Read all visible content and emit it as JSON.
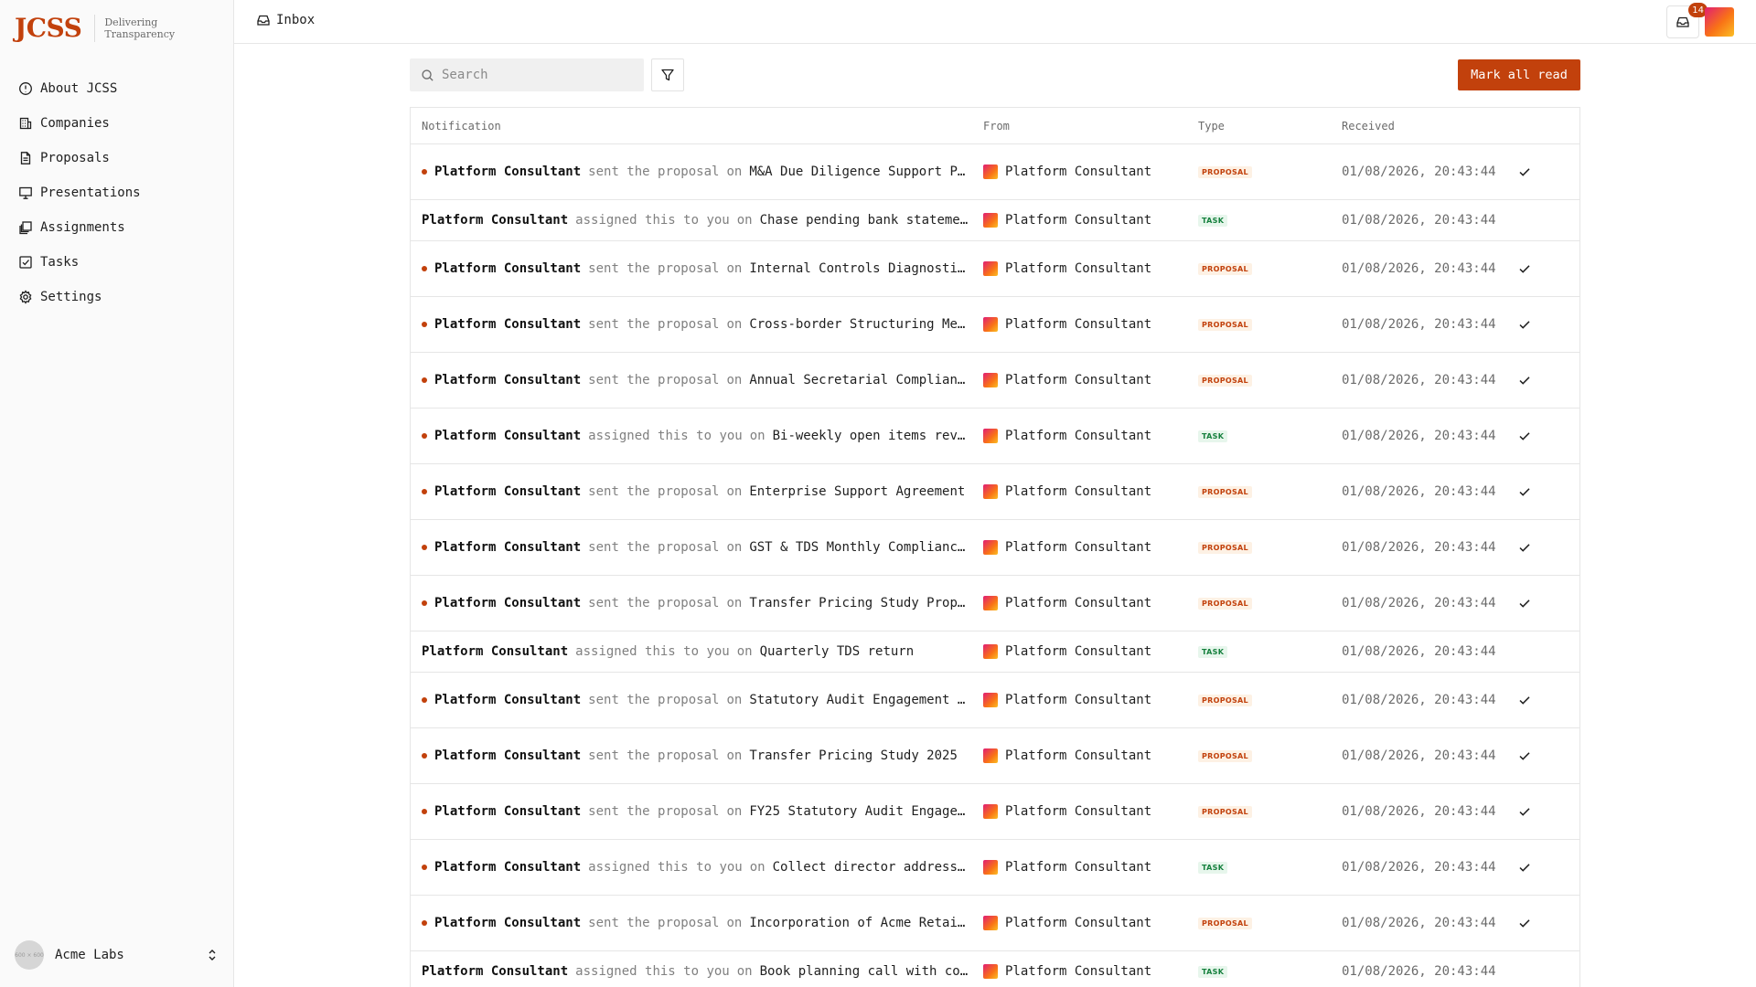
{
  "brand": {
    "logo": "JCSS",
    "tagline": "Delivering Transparency"
  },
  "sidebar": {
    "items": [
      {
        "label": "About JCSS",
        "icon": "info-icon"
      },
      {
        "label": "Companies",
        "icon": "building-icon"
      },
      {
        "label": "Proposals",
        "icon": "document-icon"
      },
      {
        "label": "Presentations",
        "icon": "presentation-icon"
      },
      {
        "label": "Assignments",
        "icon": "stack-icon"
      },
      {
        "label": "Tasks",
        "icon": "checkbox-icon"
      },
      {
        "label": "Settings",
        "icon": "gear-icon"
      }
    ],
    "workspace": {
      "name": "Acme Labs",
      "avatar_text": "600 × 600"
    }
  },
  "header": {
    "breadcrumb": "Inbox",
    "inbox_count": "14"
  },
  "toolbar": {
    "search_placeholder": "Search",
    "mark_all_read": "Mark all read"
  },
  "table": {
    "columns": {
      "notification": "Notification",
      "from": "From",
      "type": "Type",
      "received": "Received"
    },
    "rows": [
      {
        "unread": true,
        "actor": "Platform Consultant",
        "verb": "sent the proposal",
        "prep": "on",
        "subject": "M&A Due Diligence Support P…",
        "from": "Platform Consultant",
        "type": "PROPOSAL",
        "received": "01/08/2026, 20:43:44"
      },
      {
        "unread": false,
        "actor": "Platform Consultant",
        "verb": "assigned this to you",
        "prep": "on",
        "subject": "Chase pending bank stateme…",
        "from": "Platform Consultant",
        "type": "TASK",
        "received": "01/08/2026, 20:43:44"
      },
      {
        "unread": true,
        "actor": "Platform Consultant",
        "verb": "sent the proposal",
        "prep": "on",
        "subject": "Internal Controls Diagnosti…",
        "from": "Platform Consultant",
        "type": "PROPOSAL",
        "received": "01/08/2026, 20:43:44"
      },
      {
        "unread": true,
        "actor": "Platform Consultant",
        "verb": "sent the proposal",
        "prep": "on",
        "subject": "Cross-border Structuring Me…",
        "from": "Platform Consultant",
        "type": "PROPOSAL",
        "received": "01/08/2026, 20:43:44"
      },
      {
        "unread": true,
        "actor": "Platform Consultant",
        "verb": "sent the proposal",
        "prep": "on",
        "subject": "Annual Secretarial Complian…",
        "from": "Platform Consultant",
        "type": "PROPOSAL",
        "received": "01/08/2026, 20:43:44"
      },
      {
        "unread": true,
        "actor": "Platform Consultant",
        "verb": "assigned this to you",
        "prep": "on",
        "subject": "Bi-weekly open items rev…",
        "from": "Platform Consultant",
        "type": "TASK",
        "received": "01/08/2026, 20:43:44"
      },
      {
        "unread": true,
        "actor": "Platform Consultant",
        "verb": "sent the proposal",
        "prep": "on",
        "subject": "Enterprise Support Agreement",
        "from": "Platform Consultant",
        "type": "PROPOSAL",
        "received": "01/08/2026, 20:43:44"
      },
      {
        "unread": true,
        "actor": "Platform Consultant",
        "verb": "sent the proposal",
        "prep": "on",
        "subject": "GST & TDS Monthly Complianc…",
        "from": "Platform Consultant",
        "type": "PROPOSAL",
        "received": "01/08/2026, 20:43:44"
      },
      {
        "unread": true,
        "actor": "Platform Consultant",
        "verb": "sent the proposal",
        "prep": "on",
        "subject": "Transfer Pricing Study Prop…",
        "from": "Platform Consultant",
        "type": "PROPOSAL",
        "received": "01/08/2026, 20:43:44"
      },
      {
        "unread": false,
        "actor": "Platform Consultant",
        "verb": "assigned this to you",
        "prep": "on",
        "subject": "Quarterly TDS return",
        "from": "Platform Consultant",
        "type": "TASK",
        "received": "01/08/2026, 20:43:44"
      },
      {
        "unread": true,
        "actor": "Platform Consultant",
        "verb": "sent the proposal",
        "prep": "on",
        "subject": "Statutory Audit Engagement …",
        "from": "Platform Consultant",
        "type": "PROPOSAL",
        "received": "01/08/2026, 20:43:44"
      },
      {
        "unread": true,
        "actor": "Platform Consultant",
        "verb": "sent the proposal",
        "prep": "on",
        "subject": "Transfer Pricing Study 2025",
        "from": "Platform Consultant",
        "type": "PROPOSAL",
        "received": "01/08/2026, 20:43:44"
      },
      {
        "unread": true,
        "actor": "Platform Consultant",
        "verb": "sent the proposal",
        "prep": "on",
        "subject": "FY25 Statutory Audit Engage…",
        "from": "Platform Consultant",
        "type": "PROPOSAL",
        "received": "01/08/2026, 20:43:44"
      },
      {
        "unread": true,
        "actor": "Platform Consultant",
        "verb": "assigned this to you",
        "prep": "on",
        "subject": "Collect director address…",
        "from": "Platform Consultant",
        "type": "TASK",
        "received": "01/08/2026, 20:43:44"
      },
      {
        "unread": true,
        "actor": "Platform Consultant",
        "verb": "sent the proposal",
        "prep": "on",
        "subject": "Incorporation of Acme Retai…",
        "from": "Platform Consultant",
        "type": "PROPOSAL",
        "received": "01/08/2026, 20:43:44"
      },
      {
        "unread": false,
        "actor": "Platform Consultant",
        "verb": "assigned this to you",
        "prep": "on",
        "subject": "Book planning call with co…",
        "from": "Platform Consultant",
        "type": "TASK",
        "received": "01/08/2026, 20:43:44"
      }
    ]
  },
  "colors": {
    "accent": "#c2410c",
    "proposal_tag_bg": "#fdf1e4",
    "task_tag_bg": "#e7f6ec",
    "task_tag_text": "#15803d"
  }
}
